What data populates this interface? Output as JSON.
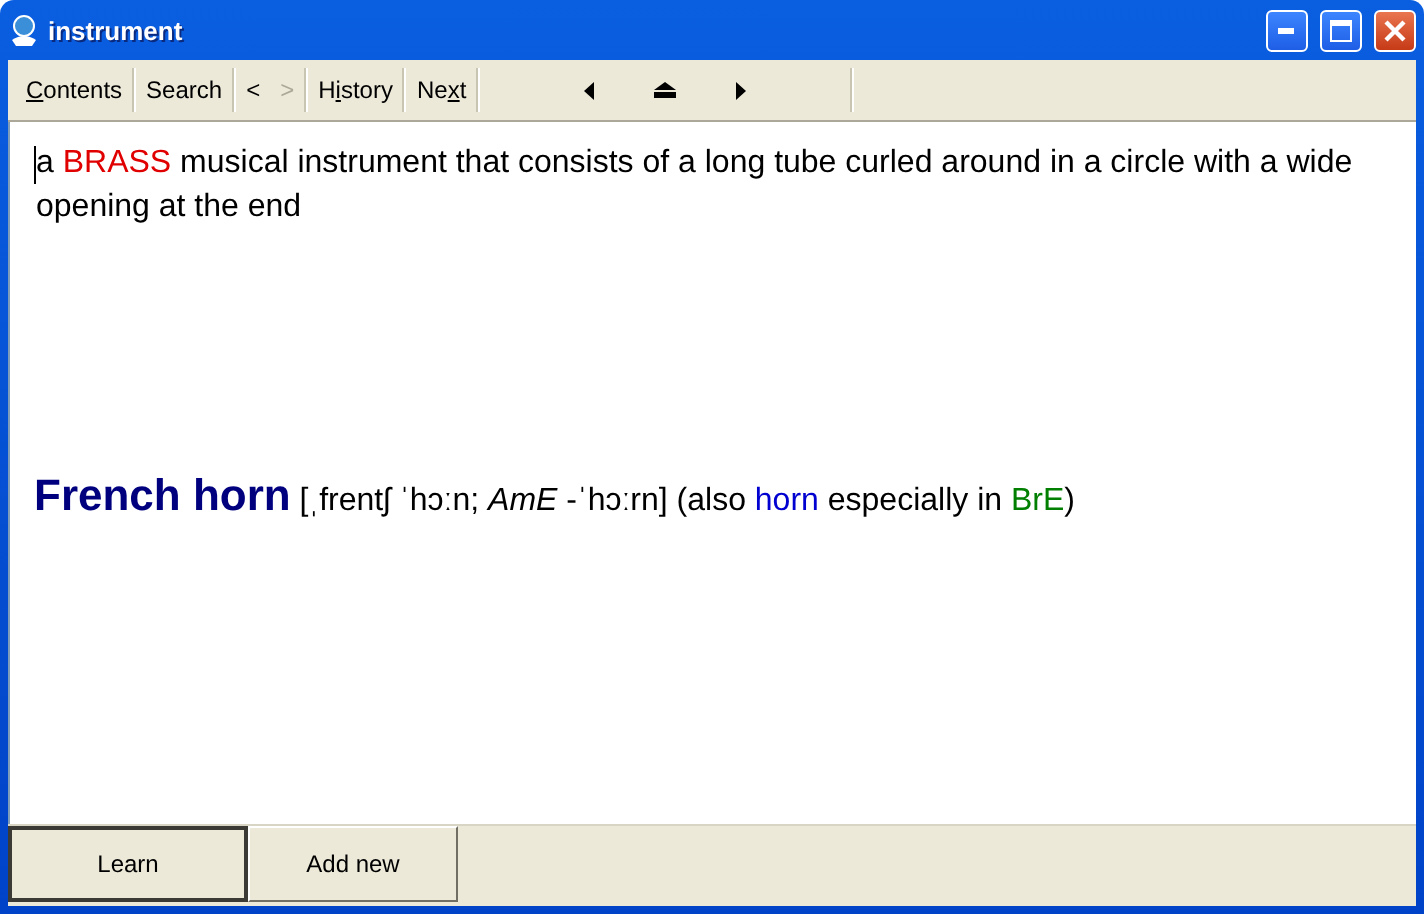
{
  "window": {
    "title": "instrument"
  },
  "toolbar": [
    {
      "kind": "text",
      "key": "C",
      "after": "ontents",
      "disabled": false
    },
    {
      "kind": "text",
      "before": "Search",
      "disabled": false
    },
    {
      "kind": "pair",
      "items": [
        {
          "label": "<",
          "disabled": false
        },
        {
          "label": ">",
          "disabled": true
        }
      ]
    },
    {
      "kind": "text",
      "before": "H",
      "key": "i",
      "after": "story",
      "disabled": false
    },
    {
      "kind": "text",
      "before": "Ne",
      "key": "x",
      "after": "t",
      "disabled": false
    },
    {
      "kind": "arrows"
    }
  ],
  "definition": [
    {
      "text": "a ",
      "kind": "plain"
    },
    {
      "text": "BRASS",
      "kind": "xref"
    },
    {
      "text": " musical instrument that consists of a long tube curled around in a circle with a wide opening at the end",
      "kind": "plain"
    }
  ],
  "entry": [
    {
      "text": "French horn",
      "kind": "headword"
    },
    {
      "text": " [ˌfrentʃ ˈhɔːn; ",
      "kind": "plain"
    },
    {
      "text": "AmE",
      "kind": "label"
    },
    {
      "text": " -ˈhɔːrn] (also ",
      "kind": "plain"
    },
    {
      "text": "horn",
      "kind": "variant"
    },
    {
      "text": " especially in ",
      "kind": "plain"
    },
    {
      "text": "BrE",
      "kind": "region"
    },
    {
      "text": ")",
      "kind": "plain"
    }
  ],
  "buttons": [
    {
      "label": "Learn",
      "selected": true
    },
    {
      "label": "Add new",
      "selected": false
    }
  ]
}
